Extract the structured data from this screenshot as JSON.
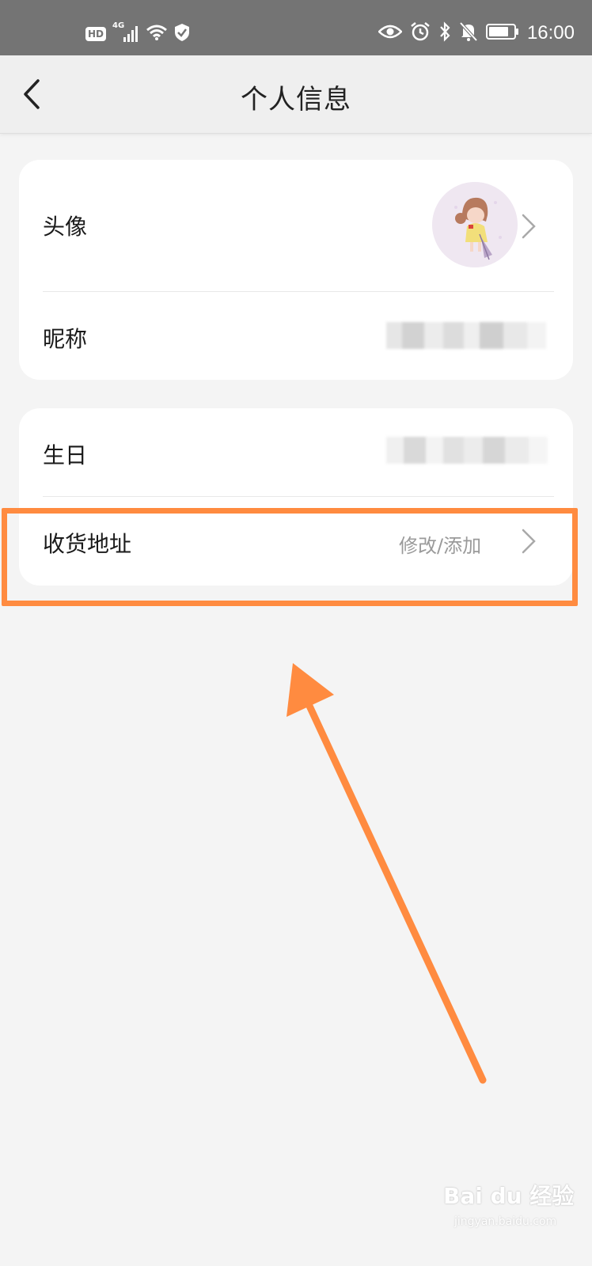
{
  "status_bar": {
    "hd_badge": "HD",
    "network": "4G",
    "time": "16:00"
  },
  "nav": {
    "title": "个人信息"
  },
  "profile_card": {
    "avatar_label": "头像",
    "nickname_label": "昵称"
  },
  "info_card": {
    "birthday_label": "生日",
    "address_label": "收货地址",
    "address_hint": "修改/添加"
  },
  "annotation": {
    "highlight_color": "#ff8b40"
  },
  "watermark": {
    "brand": "Bai du 经验",
    "url": "jingyan.baidu.com"
  },
  "icons": [
    "back-arrow-icon",
    "chevron-right-icon",
    "eye-icon",
    "alarm-icon",
    "bluetooth-icon",
    "mute-bell-icon",
    "battery-icon",
    "wifi-icon",
    "signal-icon",
    "shield-icon"
  ]
}
